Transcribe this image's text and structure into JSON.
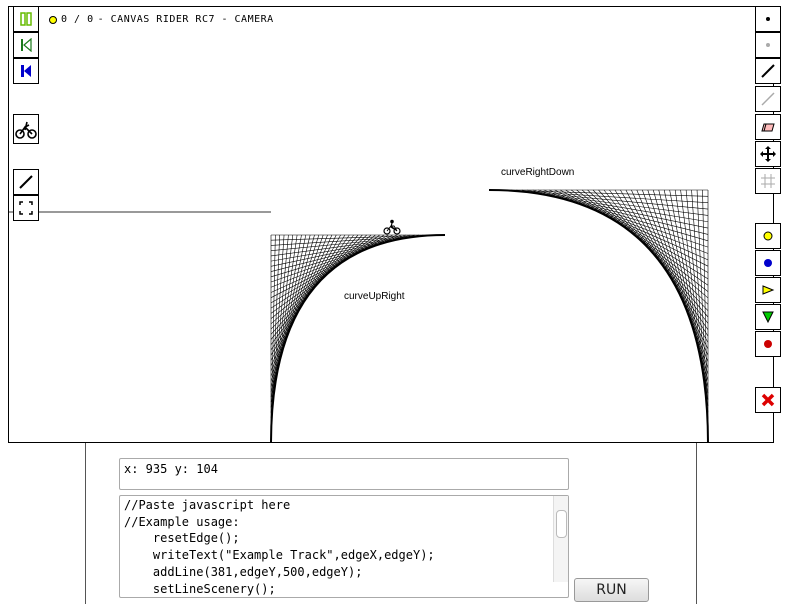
{
  "status": {
    "coins": "0 / 0",
    "title": "- CANVAS RIDER RC7 - CAMERA"
  },
  "labels": {
    "curve_up_right": "curveUpRight",
    "curve_right_down": "curveRightDown"
  },
  "left_toolbar": [
    "pause-icon",
    "previous-checkpoint-icon",
    "restart-icon",
    "bike-icon",
    "line-icon",
    "fullscreen-icon"
  ],
  "right_toolbar": [
    "point-icon",
    "scenery-point-icon",
    "line-icon",
    "scenery-line-icon",
    "eraser-icon",
    "camera-move-icon",
    "grid-icon",
    "goal-icon",
    "checkpoint-icon",
    "boost-icon",
    "gravity-icon",
    "bomb-icon",
    "clear-icon"
  ],
  "colors": {
    "goal": "#ffff00",
    "checkpoint": "#0000cc",
    "boost": "#ffff00",
    "gravity": "#00cc00",
    "bomb": "#cc0000",
    "clear": "#dd0000",
    "pause": "#66bb00",
    "restart": "#0000cc"
  },
  "coord_field": "x: 935 y: 104",
  "code_field": "//Paste javascript here\n//Example usage:\n    resetEdge();\n    writeText(\"Example Track\",edgeX,edgeY);\n    addLine(381,edgeY,500,edgeY);\n    setLineScenery();",
  "run_label": "RUN"
}
